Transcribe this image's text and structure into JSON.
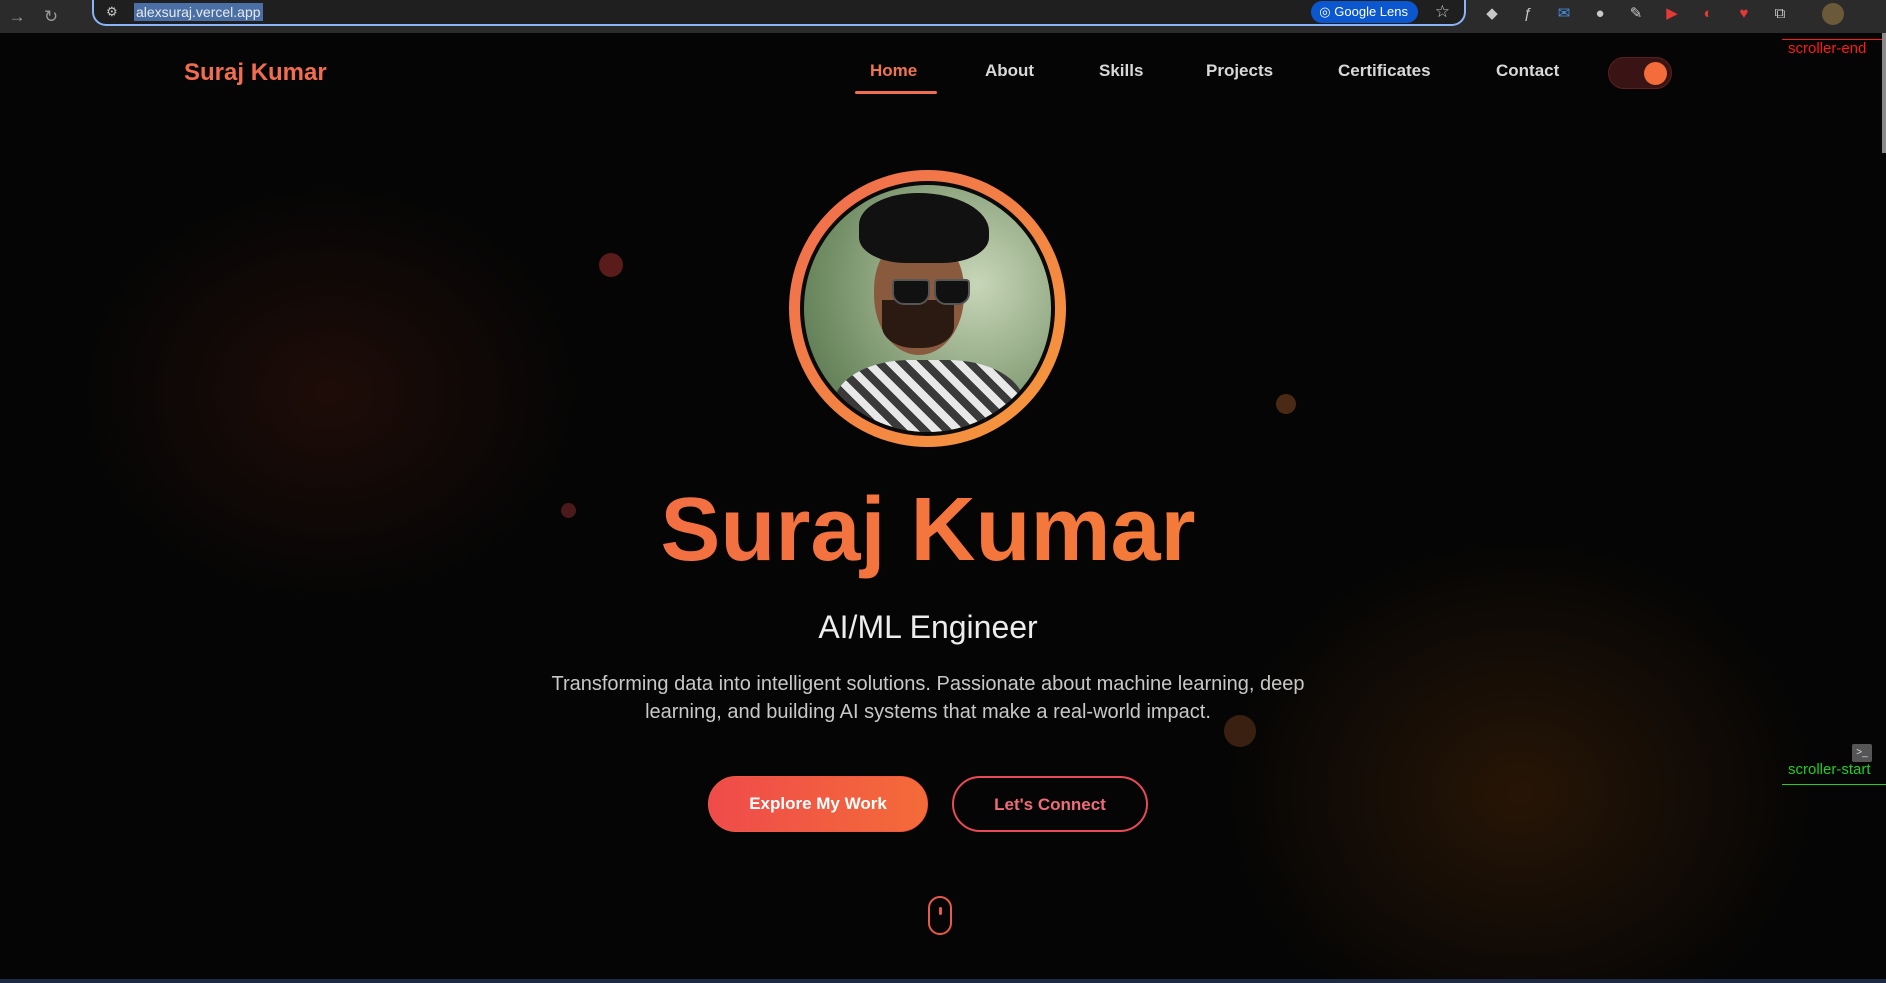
{
  "browser": {
    "url": "alexsuraj.vercel.app",
    "lens_label": "Google Lens"
  },
  "header": {
    "brand": "Suraj Kumar",
    "nav": [
      {
        "label": "Home",
        "active": true
      },
      {
        "label": "About"
      },
      {
        "label": "Skills"
      },
      {
        "label": "Projects"
      },
      {
        "label": "Certificates"
      },
      {
        "label": "Contact"
      }
    ],
    "theme_toggle": {
      "state": "on"
    }
  },
  "hero": {
    "name": "Suraj Kumar",
    "role": "AI/ML Engineer",
    "description": "Transforming data into intelligent solutions. Passionate about machine learning, deep learning, and building AI systems that make a real-world impact.",
    "primary_button": "Explore My Work",
    "secondary_button": "Let's Connect"
  },
  "overlay": {
    "scroller_end": "scroller-end",
    "scroller_start": "scroller-start"
  },
  "colors": {
    "accent": "#f26c4f",
    "accent_orange": "#f58a2e",
    "background": "#050505"
  }
}
